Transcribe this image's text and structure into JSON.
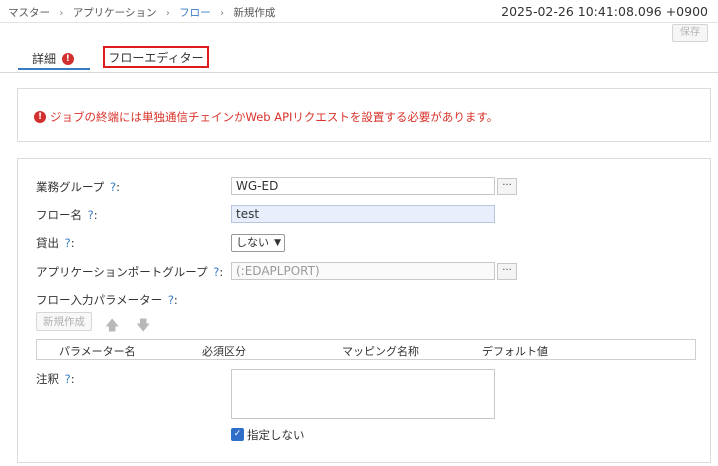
{
  "breadcrumb": {
    "items": [
      "マスター",
      "アプリケーション",
      "フロー",
      "新規作成"
    ]
  },
  "timestamp": "2025-02-26 10:41:08.096 +0900",
  "toolbar": {
    "save_label": "保存"
  },
  "tabs": {
    "detail": {
      "label": "詳細",
      "error_badge": "!"
    },
    "flow_editor": {
      "label": "フローエディター"
    }
  },
  "alert": {
    "icon": "!",
    "message": "ジョブの終端には単独通信チェインかWeb APIリクエストを設置する必要があります。"
  },
  "form": {
    "business_group": {
      "label": "業務グループ",
      "help": "?",
      "colon": ":",
      "value": "WG-ED",
      "browse": "···"
    },
    "flow_name": {
      "label": "フロー名",
      "help": "?",
      "colon": ":",
      "value": "test"
    },
    "lend": {
      "label": "貸出",
      "help": "?",
      "colon": ":",
      "selected": "しない"
    },
    "app_port_group": {
      "label": "アプリケーションポートグループ",
      "help": "?",
      "colon": ":",
      "placeholder": "(:EDAPLPORT)",
      "browse": "···"
    },
    "flow_input_params": {
      "label": "フロー入力パラメーター",
      "help": "?",
      "colon": ":",
      "new_button": "新規作成",
      "up_icon": "arrow-up-icon",
      "down_icon": "arrow-down-icon",
      "columns": [
        "パラメーター名",
        "必須区分",
        "マッピング名称",
        "デフォルト値"
      ]
    },
    "notes": {
      "label": "注釈",
      "help": "?",
      "colon": ":",
      "value": ""
    },
    "unspecified": {
      "label": "指定しない",
      "checked": true
    }
  },
  "colors": {
    "accent": "#3a7cc4",
    "error": "#d32f2f",
    "highlight_border": "#e01b1b",
    "filled_field": "#e8eefb"
  }
}
